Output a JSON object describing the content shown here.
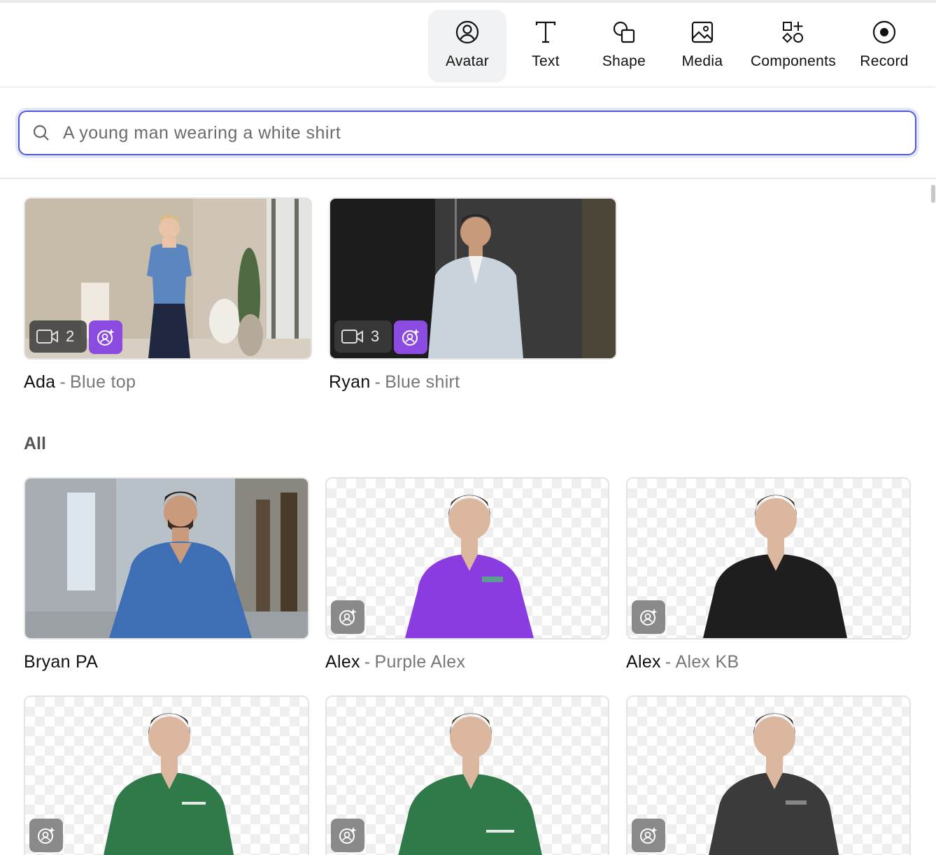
{
  "toolbar": {
    "items": [
      {
        "label": "Avatar",
        "icon": "avatar-icon",
        "active": true
      },
      {
        "label": "Text",
        "icon": "text-icon",
        "active": false
      },
      {
        "label": "Shape",
        "icon": "shape-icon",
        "active": false
      },
      {
        "label": "Media",
        "icon": "media-icon",
        "active": false
      },
      {
        "label": "Components",
        "icon": "components-icon",
        "active": false
      },
      {
        "label": "Record",
        "icon": "record-icon",
        "active": false
      }
    ]
  },
  "search": {
    "placeholder": "A young man wearing a white shirt",
    "value": ""
  },
  "featured": [
    {
      "name": "Ada",
      "separator": "-",
      "variant": "Blue top",
      "video_count": "2"
    },
    {
      "name": "Ryan",
      "separator": "-",
      "variant": "Blue shirt",
      "video_count": "3"
    }
  ],
  "all_section": {
    "title": "All",
    "avatars": [
      {
        "name": "Bryan PA",
        "separator": "",
        "variant": ""
      },
      {
        "name": "Alex",
        "separator": "-",
        "variant": "Purple Alex"
      },
      {
        "name": "Alex",
        "separator": "-",
        "variant": "Alex KB"
      },
      {
        "name": "",
        "separator": "",
        "variant": ""
      },
      {
        "name": "",
        "separator": "",
        "variant": ""
      },
      {
        "name": "",
        "separator": "",
        "variant": ""
      }
    ]
  },
  "colors": {
    "accent": "#4f5bd5",
    "ai_badge_purple": "#8b4be0",
    "ai_badge_gray": "#8a8a8a"
  }
}
